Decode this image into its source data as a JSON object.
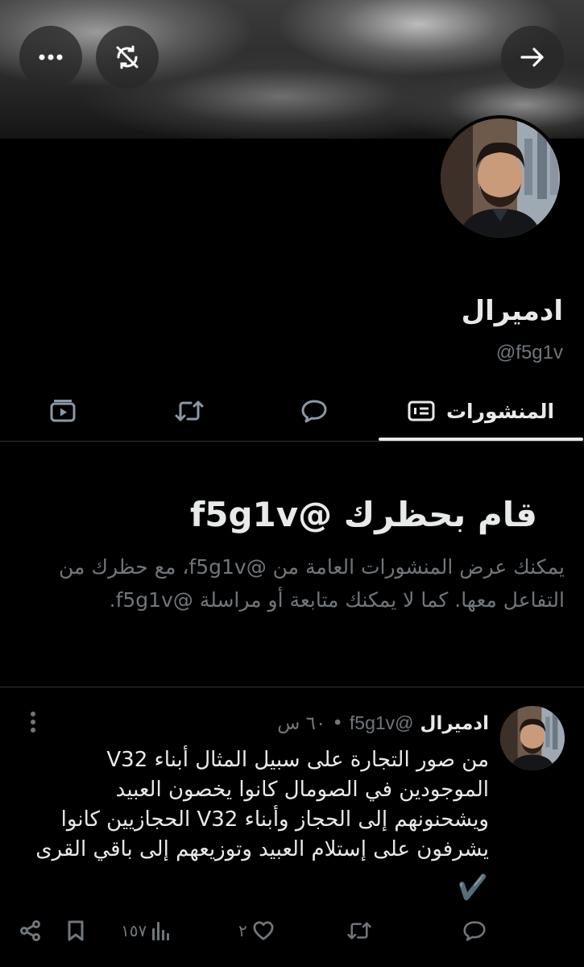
{
  "header": {
    "more_icon": "ellipsis-icon",
    "sync_icon": "sync-off-icon",
    "forward_icon": "arrow-right-icon"
  },
  "profile": {
    "name": "ادميرال",
    "handle": "@f5g1v"
  },
  "tabs": [
    {
      "label": "المنشورات",
      "icon": "posts-icon",
      "active": true
    },
    {
      "label": "",
      "icon": "reply-bubble-icon",
      "active": false
    },
    {
      "label": "",
      "icon": "repost-icon",
      "active": false
    },
    {
      "label": "",
      "icon": "media-play-icon",
      "active": false
    }
  ],
  "blocked": {
    "title": "قام بحظرك @f5g1v",
    "description": "يمكنك عرض المنشورات العامة من @f5g1v، مع حظرك من التفاعل معها. كما لا يمكنك متابعة أو مراسلة @f5g1v."
  },
  "post": {
    "author": "ادميرال",
    "handle": "@f5g1v",
    "separator": "•",
    "time": "٦٠ س",
    "text": "من صور التجارة على سبيل المثال أبناء V32 الموجودين في الصومال كانوا يخصون العبيد ويشحنونهم إلى الحجاز وأبناء V32 الحجازيين كانوا يشرفون على إستلام العبيد وتوزيعهم إلى باقي القرى",
    "checkmark": "✔️",
    "actions": {
      "replies": "",
      "reposts": "",
      "likes": "٢",
      "views": "١٥٧"
    }
  },
  "colors": {
    "background": "#000000",
    "text_primary": "#e7e9ea",
    "text_secondary": "#71767b",
    "divider": "#2f3336"
  }
}
